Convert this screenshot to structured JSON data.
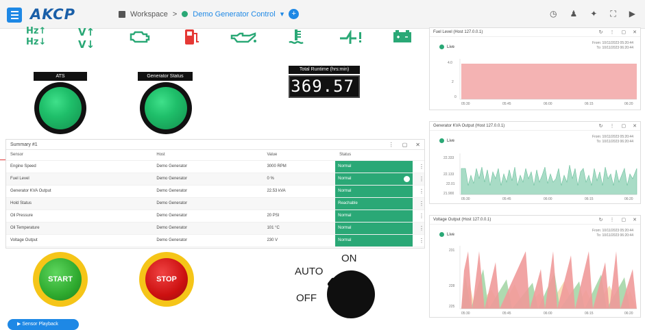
{
  "header": {
    "logo": "AKCP",
    "workspace": "Workspace",
    "separator": ">",
    "dashboard": "Demo Generator Control",
    "dropdown_caret": "▾",
    "add_label": "+",
    "icons": [
      "clock-icon",
      "user-icon",
      "pin-icon",
      "fullscreen-icon",
      "settings-icon"
    ]
  },
  "sensor_icons": [
    "frequency-icon",
    "voltage-icon",
    "engine-icon",
    "fuel-icon",
    "oil-icon",
    "temperature-icon",
    "switch-icon",
    "battery-icon"
  ],
  "gauges": {
    "ats_label": "ATS",
    "gen_status_label": "Generator Status",
    "runtime_label": "Total Runtime (hrs:min)",
    "runtime_value": "369.57"
  },
  "summary": {
    "title": "Summary #1",
    "columns": [
      "Sensor",
      "Host",
      "Value",
      "Status"
    ],
    "rows": [
      {
        "sensor": "Engine Speed",
        "host": "Demo Generator",
        "value": "3000 RPM",
        "status": "Normal"
      },
      {
        "sensor": "Fuel Level",
        "host": "Demo Generator",
        "value": "0 %",
        "status": "Normal"
      },
      {
        "sensor": "Generator KVA Output",
        "host": "Demo Generator",
        "value": "22.53 kVA",
        "status": "Normal"
      },
      {
        "sensor": "Hold Status",
        "host": "Demo Generator",
        "value": "",
        "status": "Reachable"
      },
      {
        "sensor": "Oil Pressure",
        "host": "Demo Generator",
        "value": "20 PSI",
        "status": "Normal"
      },
      {
        "sensor": "Oil Temperature",
        "host": "Demo Generator",
        "value": "101 °C",
        "status": "Normal"
      },
      {
        "sensor": "Voltage Output",
        "host": "Demo Generator",
        "value": "230 V",
        "status": "Normal"
      }
    ]
  },
  "controls": {
    "start": "START",
    "stop": "STOP",
    "auto": "AUTO",
    "on": "ON",
    "off": "OFF",
    "playback": "Sensor Playback"
  },
  "panels": [
    {
      "title": "Fuel Level (Host 127.0.0.1)",
      "live": "Live",
      "from": "From: 10/11/2023 05:20:44",
      "to": "To: 10/11/2023 06:20:44",
      "y_ticks": [
        "4.0",
        "2",
        "0"
      ],
      "x_ticks": [
        "05:30",
        "05:45",
        "06:00",
        "06:15",
        "06:20"
      ]
    },
    {
      "title": "Generator KVA Output (Host 127.0.0.1)",
      "live": "Live",
      "from": "From: 10/11/2023 05:20:44",
      "to": "To: 10/11/2023 06:20:44",
      "y_ticks": [
        "22.333",
        "22.133",
        "22.01",
        "21.900"
      ],
      "x_ticks": [
        "05:30",
        "05:45",
        "06:00",
        "06:15",
        "06:20"
      ]
    },
    {
      "title": "Voltage Output (Host 127.0.0.1)",
      "live": "Live",
      "from": "From: 10/11/2023 05:20:44",
      "to": "To: 10/11/2023 06:20:44",
      "y_ticks": [
        "231",
        "228",
        "225"
      ],
      "x_ticks": [
        "05:30",
        "05:45",
        "06:00",
        "06:15",
        "06:20"
      ]
    }
  ],
  "colors": {
    "accent": "#1e88e5",
    "normal": "#2aa876",
    "fuel_fill": "#f4b3b3",
    "kva_fill": "#a8dcc6",
    "volt_red": "#ef9a9a",
    "volt_green": "#a5d6a7",
    "volt_yellow": "#f5deb3"
  }
}
